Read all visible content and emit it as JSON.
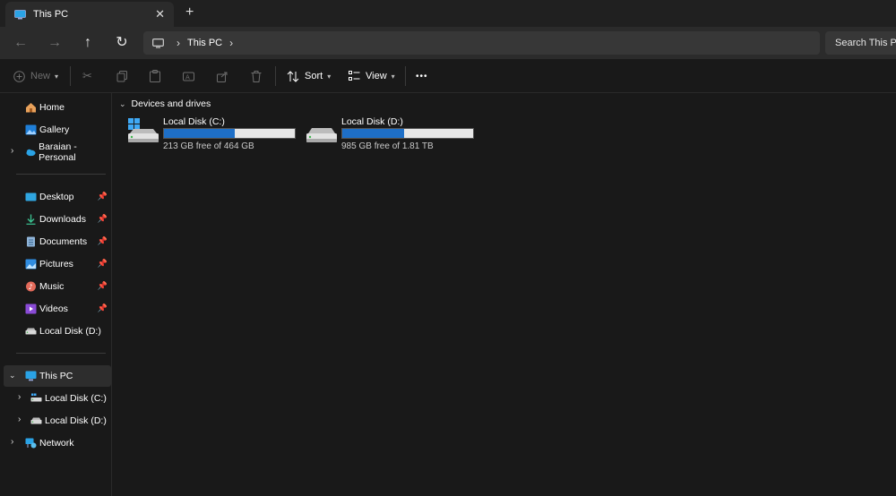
{
  "window": {
    "tab_title": "This PC",
    "close_glyph": "✕",
    "new_tab_glyph": "+"
  },
  "address_bar": {
    "breadcrumb": [
      "This PC"
    ],
    "search_placeholder": "Search This PC"
  },
  "command_bar": {
    "new_label": "New",
    "sort_label": "Sort",
    "view_label": "View",
    "more_label": "•••"
  },
  "sidebar": {
    "top_items": [
      {
        "label": "Home",
        "icon": "home-icon"
      },
      {
        "label": "Gallery",
        "icon": "gallery-icon"
      },
      {
        "label": "Baraian - Personal",
        "icon": "onedrive-cloud-icon"
      }
    ],
    "quick_access": [
      {
        "label": "Desktop",
        "icon": "desktop-folder-icon"
      },
      {
        "label": "Downloads",
        "icon": "download-arrow-icon"
      },
      {
        "label": "Documents",
        "icon": "documents-icon"
      },
      {
        "label": "Pictures",
        "icon": "pictures-icon"
      },
      {
        "label": "Music",
        "icon": "music-icon"
      },
      {
        "label": "Videos",
        "icon": "videos-icon"
      },
      {
        "label": "Local Disk (D:)",
        "icon": "drive-icon"
      }
    ],
    "tree": {
      "this_pc": "This PC",
      "drives": [
        "Local Disk (C:)",
        "Local Disk (D:)"
      ],
      "network": "Network"
    }
  },
  "main": {
    "section_title": "Devices and drives",
    "drives": [
      {
        "name": "Local Disk (C:)",
        "free_text": "213 GB free of 464 GB",
        "used_fraction": 0.54
      },
      {
        "name": "Local Disk (D:)",
        "free_text": "985 GB free of 1.81 TB",
        "used_fraction": 0.47
      }
    ]
  },
  "colors": {
    "accent": "#1e6fc7",
    "background": "#191919",
    "toolbar": "#2b2b2b"
  }
}
